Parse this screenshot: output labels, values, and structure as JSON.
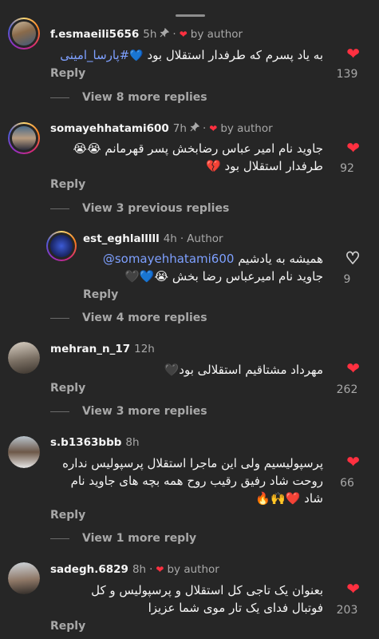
{
  "colors": {
    "background": "#262626",
    "like_red": "#ff3040",
    "mention_blue": "#7ea0ff",
    "muted": "#a8a8a8"
  },
  "comments": [
    {
      "username": "f.esmaeili5656",
      "time": "5h",
      "pinned": true,
      "by_author": "by author",
      "text_main": "به یاد پسرم که طرفدار استقلال بود",
      "emoji": "💙",
      "hashtag": "#پارسا_امینی",
      "reply_label": "Reply",
      "likes": "139",
      "view_more": "View 8 more replies"
    },
    {
      "username": "somayehhatami600",
      "time": "7h",
      "pinned": true,
      "by_author": "by author",
      "line1": "جاوید نام امیر عباس رضابخش پسر قهرمانم 😭😭",
      "line2": "طرفدار استقلال بود 💔",
      "reply_label": "Reply",
      "likes": "92",
      "view_more": "View 3 previous replies"
    },
    {
      "username": "est_eghlalllll",
      "time": "4h",
      "author_label": "Author",
      "mention": "@somayehhatami600",
      "line1_rest": "همیشه به یادشیم",
      "line2": "جاوید نام امیرعباس رضا بخش 😭💙🖤",
      "reply_label": "Reply",
      "likes": "9",
      "view_more": "View 4 more replies"
    },
    {
      "username": "mehran_n_17",
      "time": "12h",
      "text_main": "مهرداد مشتاقیم استقلالی بود🖤",
      "reply_label": "Reply",
      "likes": "262",
      "view_more": "View 3 more replies"
    },
    {
      "username": "s.b1363bbb",
      "time": "8h",
      "line1": "پرسپولیسیم ولی این ماجرا استقلال پرسپولیس نداره",
      "line2": "روحت شاد رفیق رقیب روح همه بچه های جاوید نام",
      "line3": "شاد ❤️🙌🔥",
      "reply_label": "Reply",
      "likes": "66",
      "view_more": "View 1 more reply"
    },
    {
      "username": "sadegh.6829",
      "time": "8h",
      "by_author": "by author",
      "line1": "بعنوان یک تاجی کل استقلال و پرسپولیس و کل",
      "line2": "فوتبال فدای یک تار موی شما عزیزا",
      "reply_label": "Reply",
      "likes": "203"
    }
  ]
}
